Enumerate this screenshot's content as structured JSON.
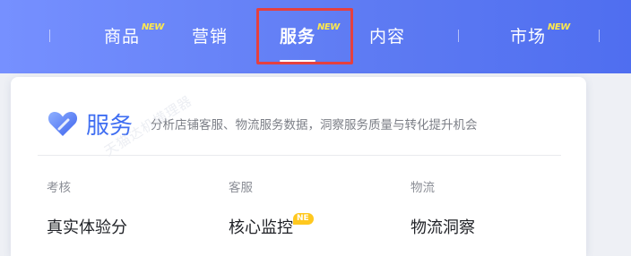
{
  "nav": {
    "items": [
      {
        "label": "商品",
        "badge": "NEW",
        "active": false
      },
      {
        "label": "营销",
        "badge": "",
        "active": false
      },
      {
        "label": "服务",
        "badge": "NEW",
        "active": true
      },
      {
        "label": "内容",
        "badge": "",
        "active": false
      },
      {
        "label": "市场",
        "badge": "NEW",
        "active": false
      }
    ]
  },
  "panel": {
    "title": "服务",
    "description": "分析店铺客服、物流服务数据，洞察服务质量与转化提升机会",
    "watermark": "天猫达机横理器",
    "columns": [
      {
        "heading": "考核",
        "items": [
          {
            "label": "真实体验分",
            "badge": ""
          }
        ]
      },
      {
        "heading": "客服",
        "items": [
          {
            "label": "核心监控",
            "badge": "NE"
          }
        ]
      },
      {
        "heading": "物流",
        "items": [
          {
            "label": "物流洞察",
            "badge": ""
          }
        ]
      }
    ]
  },
  "colors": {
    "nav_gradient_start": "#7690ff",
    "nav_gradient_end": "#4f6ef0",
    "badge_yellow": "#ffe94d",
    "title_blue": "#3f6ef2",
    "highlight_red": "#e5403f"
  }
}
